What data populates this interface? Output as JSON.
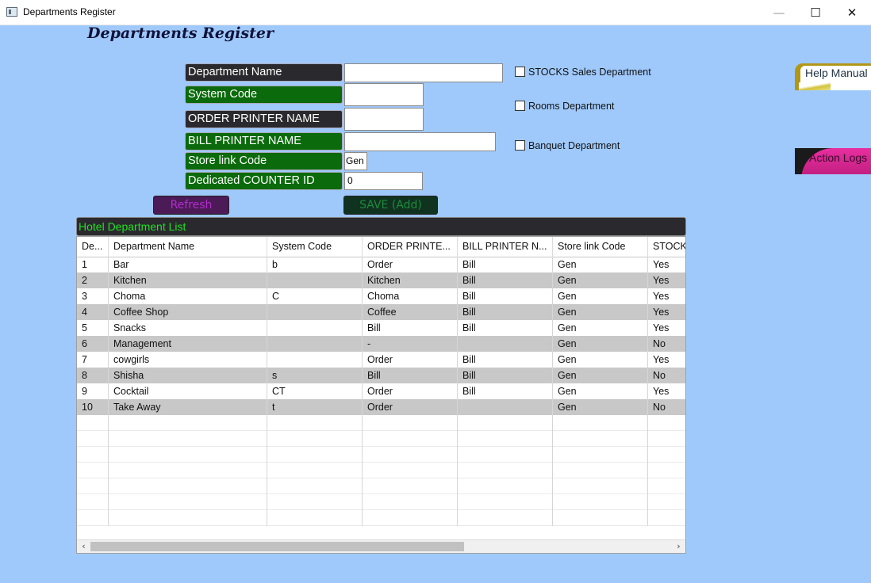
{
  "window": {
    "title": "Departments Register",
    "minimize_glyph": "—",
    "maximize_glyph": "☐",
    "close_glyph": "✕"
  },
  "page": {
    "heading": "Departments Register"
  },
  "form": {
    "department_name": {
      "label": "Department Name",
      "value": ""
    },
    "system_code": {
      "label": "System Code",
      "value": ""
    },
    "order_printer_name": {
      "label": "ORDER PRINTER NAME",
      "value": ""
    },
    "bill_printer_name": {
      "label": "BILL PRINTER NAME",
      "value": ""
    },
    "store_link_code": {
      "label": "Store link Code",
      "value": "Gen"
    },
    "dedicated_counter_id": {
      "label": "Dedicated COUNTER ID",
      "value": "0"
    }
  },
  "checkboxes": [
    {
      "label": "STOCKS Sales Department",
      "checked": false
    },
    {
      "label": "Rooms Department",
      "checked": false
    },
    {
      "label": "Banquet Department",
      "checked": false
    }
  ],
  "buttons": {
    "refresh": "Refresh",
    "save": "SAVE (Add)"
  },
  "side_buttons": {
    "help_manual": "Help Manual",
    "action_logs": "Action Logs"
  },
  "list": {
    "title": "Hotel Department List",
    "columns": [
      "De...",
      "Department Name",
      "System Code",
      "ORDER PRINTE...",
      "BILL PRINTER N...",
      "Store link Code",
      "STOCKS"
    ],
    "rows": [
      [
        "1",
        "Bar",
        "b",
        "Order",
        "Bill",
        "Gen",
        "Yes"
      ],
      [
        "2",
        "Kitchen",
        "",
        "Kitchen",
        "Bill",
        "Gen",
        "Yes"
      ],
      [
        "3",
        "Choma",
        "C",
        "Choma",
        "Bill",
        "Gen",
        "Yes"
      ],
      [
        "4",
        "Coffee Shop",
        "",
        "Coffee",
        "Bill",
        "Gen",
        "Yes"
      ],
      [
        "5",
        "Snacks",
        "",
        "Bill",
        "Bill",
        "Gen",
        "Yes"
      ],
      [
        "6",
        "Management",
        "",
        "-",
        "",
        "Gen",
        "No"
      ],
      [
        "7",
        "cowgirls",
        "",
        "Order",
        "Bill",
        "Gen",
        "Yes"
      ],
      [
        "8",
        "Shisha",
        "s",
        "Bill",
        "Bill",
        "Gen",
        "No"
      ],
      [
        "9",
        "Cocktail",
        "CT",
        "Order",
        "Bill",
        "Gen",
        "Yes"
      ],
      [
        "10",
        "Take Away",
        "t",
        "Order",
        "",
        "Gen",
        "No"
      ]
    ],
    "scroll_left_glyph": "‹",
    "scroll_right_glyph": "›"
  },
  "colors": {
    "background": "#9fc9fb",
    "label_dark": "#2a2a2e",
    "label_green": "#0b6a0b",
    "list_title_text": "#22e022"
  }
}
